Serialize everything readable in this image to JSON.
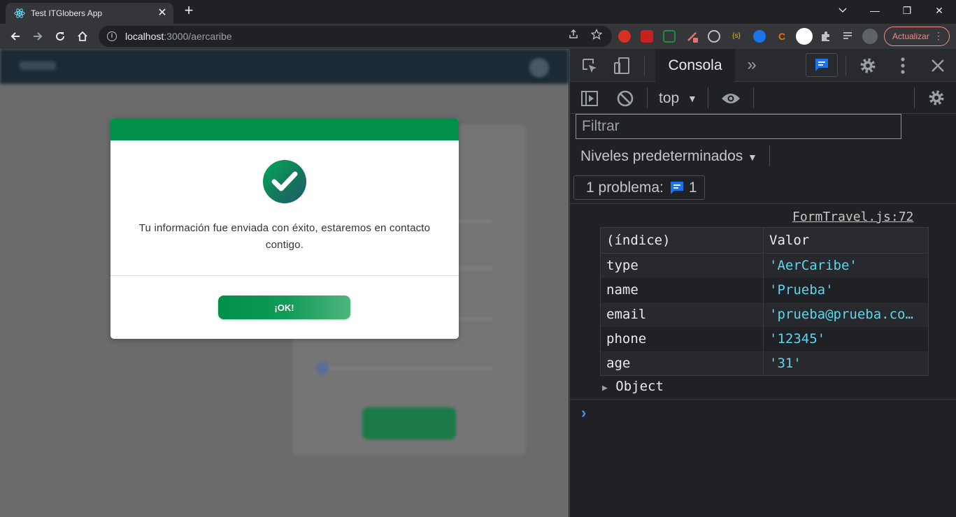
{
  "browser": {
    "tab_title": "Test ITGlobers App",
    "tab_close": "✕",
    "new_tab": "+",
    "window_controls": {
      "minimize": "—",
      "restore": "❐",
      "close": "✕"
    },
    "url_host": "localhost",
    "url_path": ":3000/aercaribe",
    "update_button": "Actualizar",
    "menu_glyph": "⋮"
  },
  "modal": {
    "message": "Tu información fue enviada con éxito, estaremos en contacto contigo.",
    "ok_button": "¡OK!"
  },
  "devtools": {
    "tab_console": "Consola",
    "more_tabs": "»",
    "context": "top",
    "filter_placeholder": "Filtrar",
    "levels": "Niveles predeterminados",
    "issues_label": "1 problema:",
    "issues_count": "1",
    "source_link": "FormTravel.js:72",
    "table": {
      "headers": [
        "(índice)",
        "Valor"
      ],
      "rows": [
        {
          "key": "type",
          "value": "'AerCaribe'"
        },
        {
          "key": "name",
          "value": "'Prueba'"
        },
        {
          "key": "email",
          "value": "'prueba@prueba.co…"
        },
        {
          "key": "phone",
          "value": "'12345'"
        },
        {
          "key": "age",
          "value": "'31'"
        }
      ]
    },
    "object_label": "Object",
    "prompt": "›"
  },
  "colors": {
    "modal_header": "#00904a",
    "ok_gradient_start": "#00904a",
    "ok_gradient_end": "#4db57f",
    "console_string": "#5cd5ed",
    "update_accent": "#f28b82"
  }
}
